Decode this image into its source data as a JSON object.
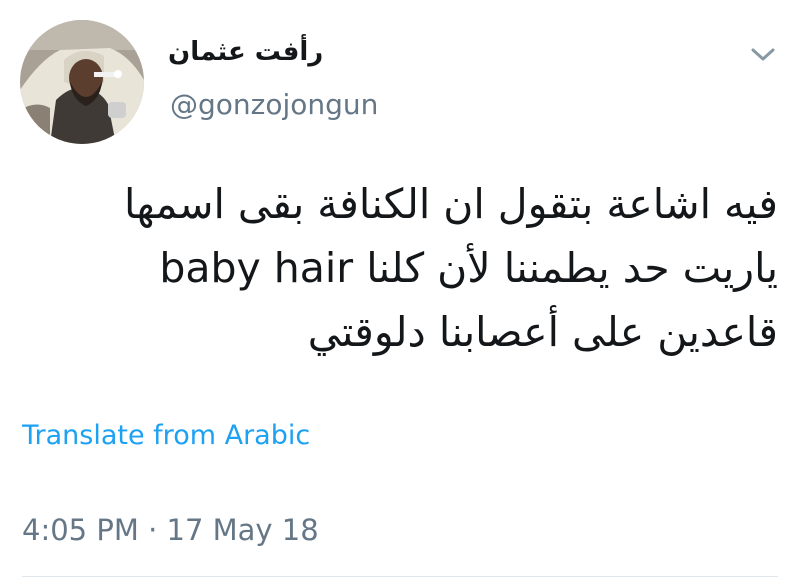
{
  "tweet": {
    "display_name": "رأفت عثمان",
    "username": "@gonzojongun",
    "text_lines": [
      "فيه اشاعة بتقول ان الكنافة بقى اسمها",
      "baby hair ياريت حد يطمننا لأن كلنا",
      "قاعدين على أعصابنا دلوقتي"
    ],
    "translate_label": "Translate from Arabic",
    "timestamp": "4:05 PM · 17 May 18"
  },
  "icons": {
    "menu": "chevron-down-icon",
    "avatar": "profile-photo"
  },
  "colors": {
    "text": "#14171a",
    "secondary_text": "#657786",
    "link": "#1da1f2",
    "divider": "#e1e8ed",
    "chevron": "#8899a6"
  }
}
